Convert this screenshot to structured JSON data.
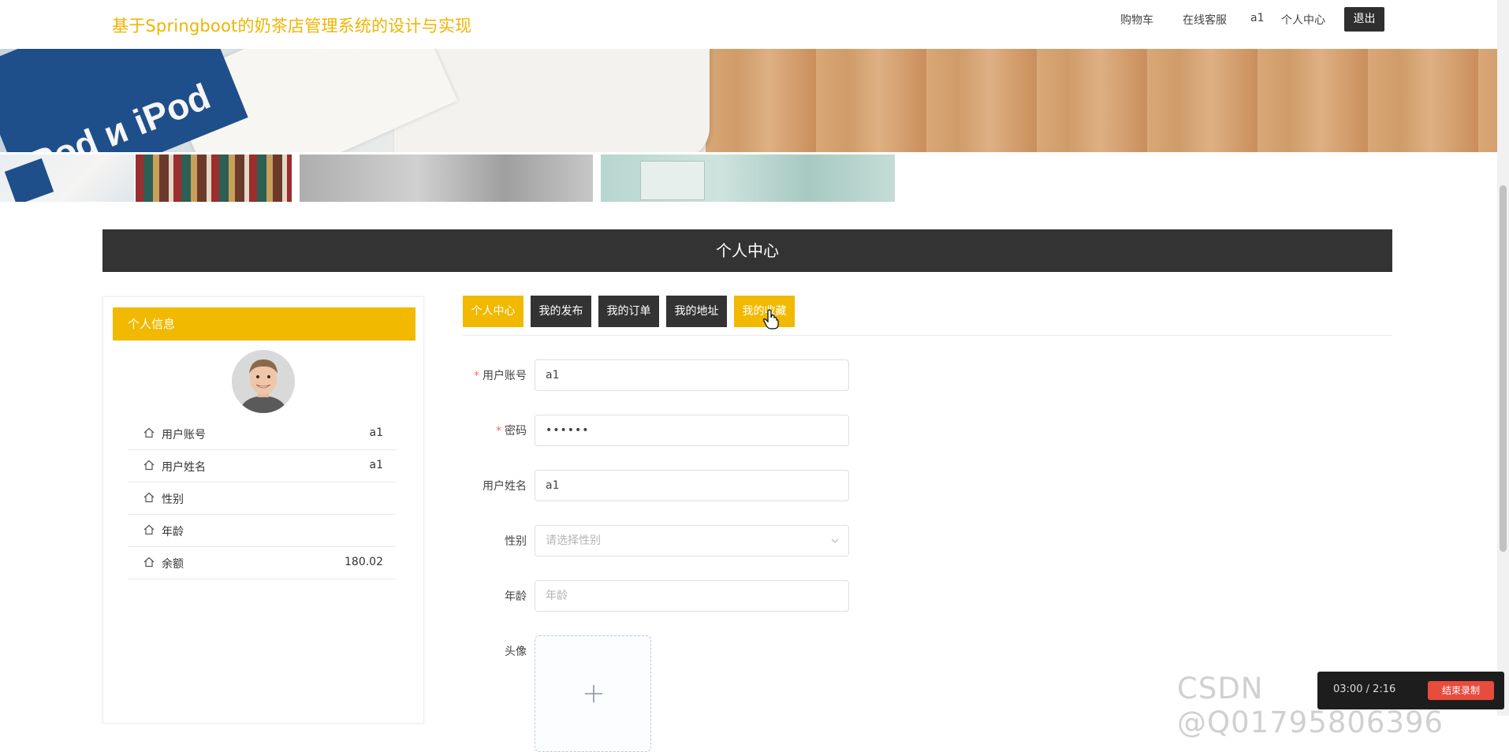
{
  "header": {
    "site_title": "基于Springboot的奶茶店管理系统的设计与实现",
    "nav": {
      "cart": "购物车",
      "service": "在线客服",
      "username": "a1",
      "profile": "个人中心",
      "logout": "退出"
    }
  },
  "section_title": "个人中心",
  "profile_card": {
    "title": "个人信息",
    "rows": [
      {
        "label": "用户账号",
        "value": "a1"
      },
      {
        "label": "用户姓名",
        "value": "a1"
      },
      {
        "label": "性别",
        "value": ""
      },
      {
        "label": "年龄",
        "value": ""
      },
      {
        "label": "余额",
        "value": "180.02"
      }
    ]
  },
  "tabs": [
    "个人中心",
    "我的发布",
    "我的订单",
    "我的地址",
    "我的收藏"
  ],
  "form": {
    "account": {
      "label": "用户账号",
      "value": "a1",
      "required": true
    },
    "password": {
      "label": "密码",
      "value": "••••••",
      "required": true
    },
    "name": {
      "label": "用户姓名",
      "value": "a1"
    },
    "gender": {
      "label": "性别",
      "placeholder": "请选择性别"
    },
    "age": {
      "label": "年龄",
      "placeholder": "年龄"
    },
    "avatar": {
      "label": "头像"
    }
  },
  "overlay": {
    "watermark": "CSDN @Q0179580639​6",
    "corner_time": "03:00 / 2:16",
    "corner_button": "结束录制"
  },
  "colors": {
    "accent": "#f1b900",
    "title": "#f0b400",
    "dark": "#333333",
    "required": "#f56c6c"
  }
}
